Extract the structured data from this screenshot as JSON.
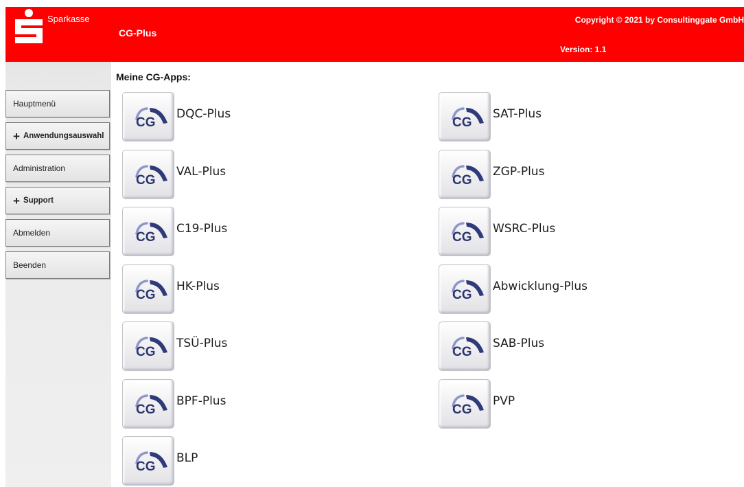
{
  "header": {
    "brand": "Sparkasse",
    "app_title": "CG-Plus",
    "copyright": "Copyright ©  2021 by Consultinggate GmbH",
    "version": "Version: 1.1",
    "color": "#fe0000"
  },
  "sidebar": {
    "items": [
      {
        "label": "Hauptmenü",
        "expandable": false
      },
      {
        "label": "Anwendungsauswahl",
        "expandable": true
      },
      {
        "label": "Administration",
        "expandable": false
      },
      {
        "label": "Support",
        "expandable": true
      },
      {
        "label": "Abmelden",
        "expandable": false
      },
      {
        "label": "Beenden",
        "expandable": false
      }
    ],
    "expand_symbol": "+"
  },
  "main": {
    "title": "Meine CG-Apps:",
    "icon_text": "CG",
    "apps": [
      {
        "label": "DQC-Plus"
      },
      {
        "label": "SAT-Plus"
      },
      {
        "label": "VAL-Plus"
      },
      {
        "label": "ZGP-Plus"
      },
      {
        "label": "C19-Plus"
      },
      {
        "label": "WSRC-Plus"
      },
      {
        "label": "HK-Plus"
      },
      {
        "label": "Abwicklung-Plus"
      },
      {
        "label": "TSÜ-Plus"
      },
      {
        "label": "SAB-Plus"
      },
      {
        "label": "BPF-Plus"
      },
      {
        "label": "PVP"
      },
      {
        "label": "BLP"
      }
    ]
  }
}
